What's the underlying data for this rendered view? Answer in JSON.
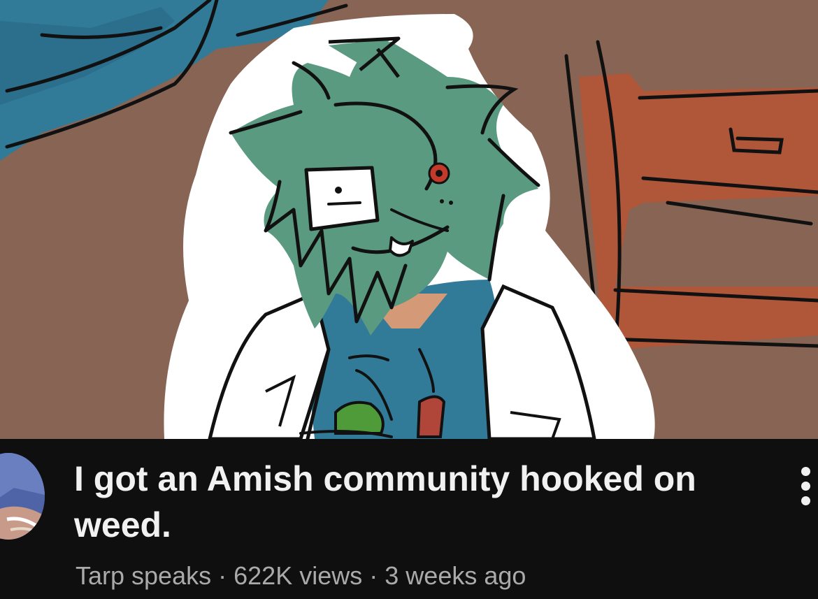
{
  "video": {
    "title": "I got an Amish community hooked on weed.",
    "channel": "Tarp speaks",
    "separator": "·",
    "views": "622K views",
    "age": "3 weeks ago"
  },
  "icons": {
    "more": "more-vertical-icon",
    "avatar": "channel-avatar"
  },
  "colors": {
    "background": "#0f0f0f",
    "title_text": "#f1f1f1",
    "meta_text": "#aaaaaa",
    "thumbnail_wall": "#876453",
    "hair": "#5a9a80",
    "shirt": "#317b98",
    "furniture": "#b0573a"
  }
}
